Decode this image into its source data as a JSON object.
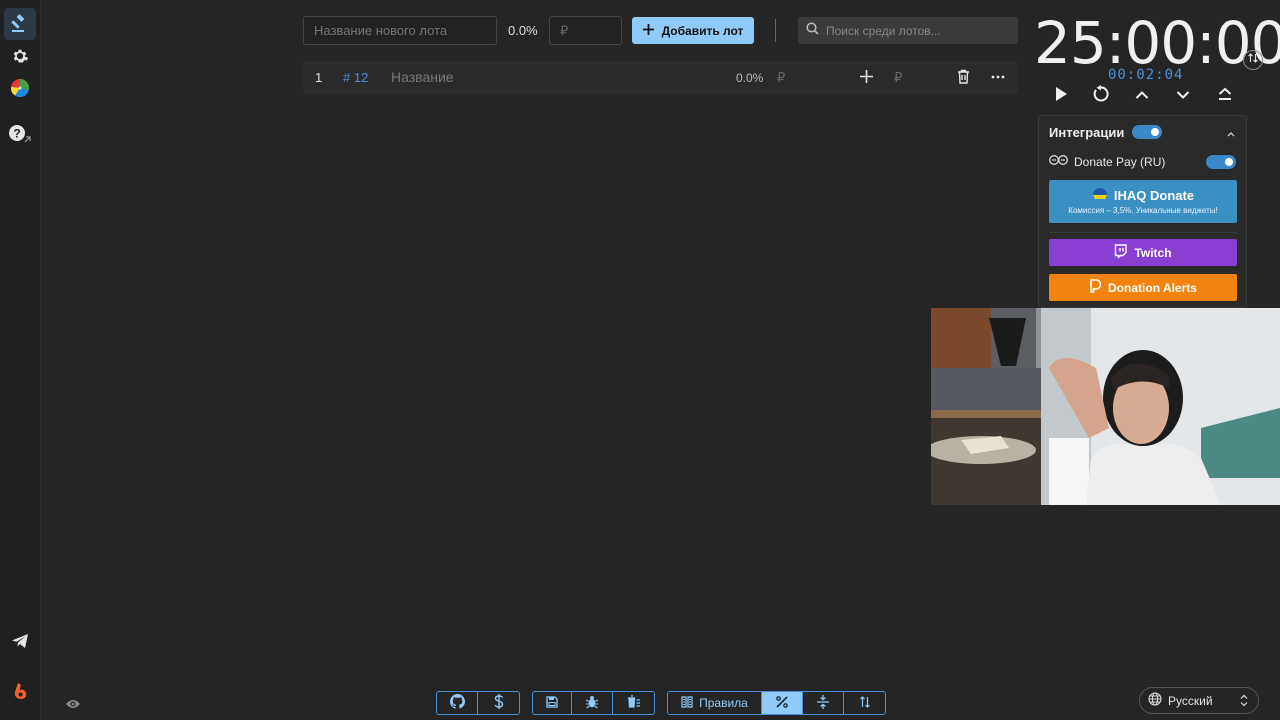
{
  "sidebar": {
    "items": [
      {
        "name": "auction-icon",
        "active": true
      },
      {
        "name": "settings-icon"
      },
      {
        "name": "wheel-icon"
      },
      {
        "name": "help-icon"
      }
    ],
    "bottom": [
      {
        "name": "telegram-icon"
      },
      {
        "name": "boosty-icon"
      }
    ]
  },
  "topbar": {
    "lot_name_placeholder": "Название нового лота",
    "percent": "0.0%",
    "amount_placeholder": "₽",
    "add_lot_label": "Добавить лот",
    "search_placeholder": "Поиск среди лотов..."
  },
  "lots": [
    {
      "index": "1",
      "id": "# 12",
      "name": "Название",
      "percent": "0.0%",
      "currency": "₽",
      "currency2": "₽"
    }
  ],
  "timer": {
    "main": "25:00:00",
    "elapsed": "00:02:04"
  },
  "integrations": {
    "title": "Интеграции",
    "enabled": true,
    "donatepay_label": "Donate Pay (RU)",
    "donatepay_enabled": true,
    "ihaq_title": "IHAQ Donate",
    "ihaq_subtitle": "Комиссия – 3,5%. Уникальные виджеты!",
    "twitch_label": "Twitch",
    "donation_alerts_label": "Donation Alerts",
    "colors": {
      "ihaq": "#3a8fc3",
      "twitch": "#8a3fd3",
      "donation_alerts": "#f3830f",
      "accent": "#90caf9"
    }
  },
  "bottom_toolbar": {
    "rules_label": "Правила"
  },
  "language": {
    "selected": "Русский"
  }
}
